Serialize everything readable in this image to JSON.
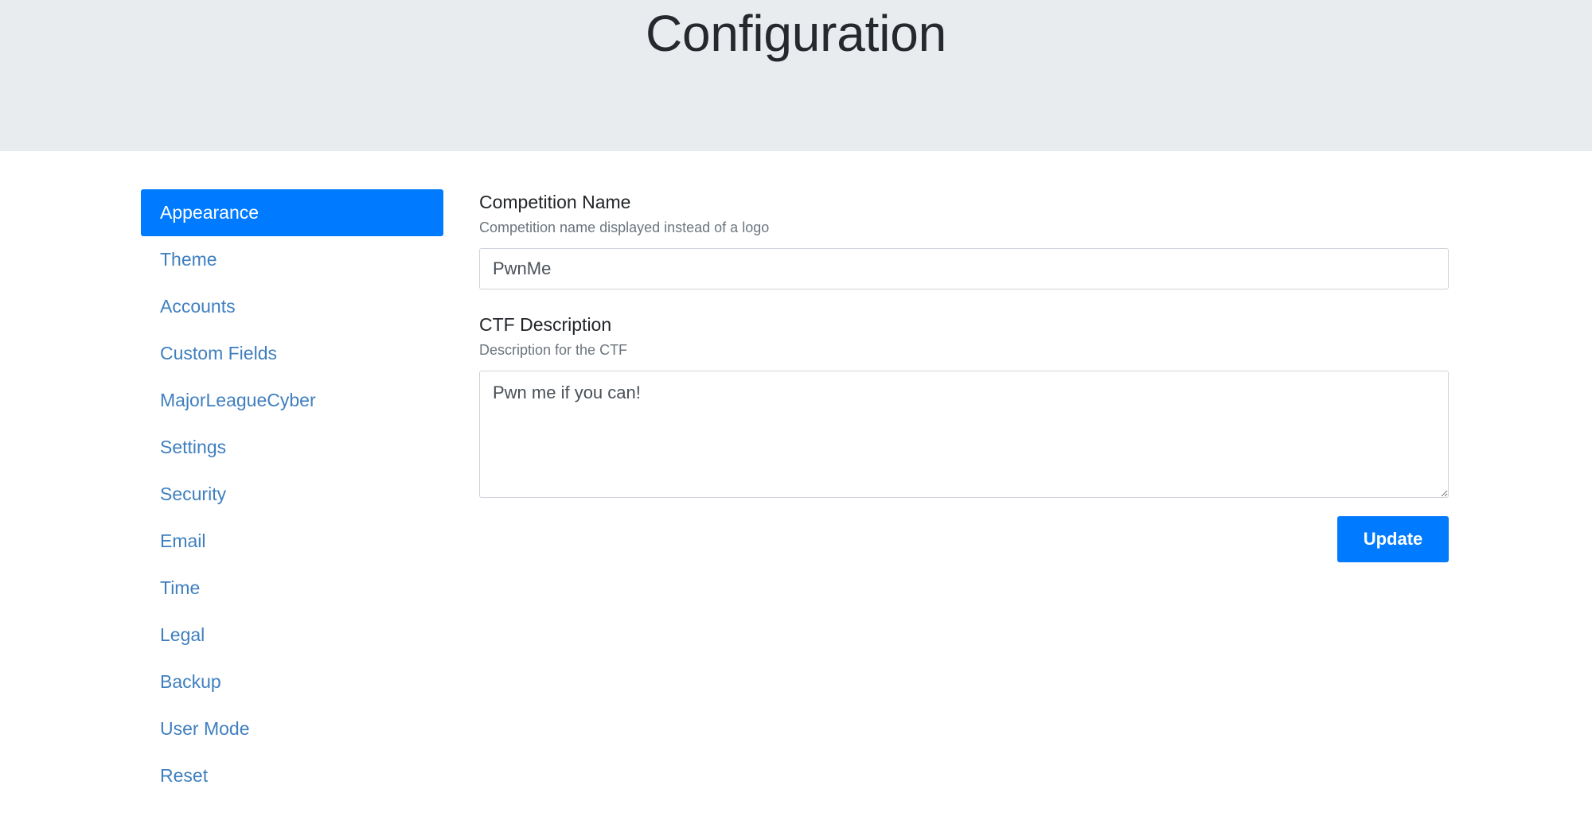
{
  "header": {
    "title": "Configuration",
    "background_color": "#e9ecef"
  },
  "theme": {
    "accent_color": "#007bff",
    "link_color": "#3f7fbf",
    "text_color": "#212529",
    "muted_color": "#6c757d",
    "border_color": "#ced4da"
  },
  "sidebar": {
    "items": [
      {
        "label": "Appearance",
        "active": true
      },
      {
        "label": "Theme",
        "active": false
      },
      {
        "label": "Accounts",
        "active": false
      },
      {
        "label": "Custom Fields",
        "active": false
      },
      {
        "label": "MajorLeagueCyber",
        "active": false
      },
      {
        "label": "Settings",
        "active": false
      },
      {
        "label": "Security",
        "active": false
      },
      {
        "label": "Email",
        "active": false
      },
      {
        "label": "Time",
        "active": false
      },
      {
        "label": "Legal",
        "active": false
      },
      {
        "label": "Backup",
        "active": false
      },
      {
        "label": "User Mode",
        "active": false
      },
      {
        "label": "Reset",
        "active": false
      }
    ]
  },
  "form": {
    "competition_name": {
      "label": "Competition Name",
      "help": "Competition name displayed instead of a logo",
      "value": "PwnMe",
      "placeholder": ""
    },
    "ctf_description": {
      "label": "CTF Description",
      "help": "Description for the CTF",
      "value": "Pwn me if you can!",
      "placeholder": ""
    },
    "submit_label": "Update"
  }
}
